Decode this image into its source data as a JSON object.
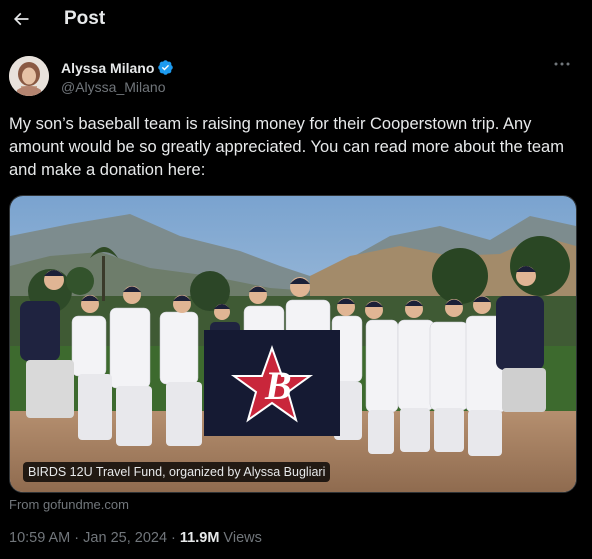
{
  "header": {
    "title": "Post"
  },
  "author": {
    "display_name": "Alyssa Milano",
    "handle": "@Alyssa_Milano"
  },
  "tweet": {
    "text": "My son’s baseball team is raising money for their Cooperstown trip. Any amount would be so greatly appreciated. You can read more about the team and make a donation here:"
  },
  "card": {
    "caption": "BIRDS 12U Travel Fund, organized by Alyssa Bugliari",
    "source": "From gofundme.com"
  },
  "meta": {
    "time": "10:59 AM",
    "separator1": " · ",
    "date": "Jan 25, 2024",
    "separator2": " · ",
    "views_count": "11.9M",
    "views_label": " Views"
  },
  "colors": {
    "accent": "#1d9bf0",
    "text": "#e7e9ea",
    "muted": "#71767b",
    "background": "#000000"
  }
}
